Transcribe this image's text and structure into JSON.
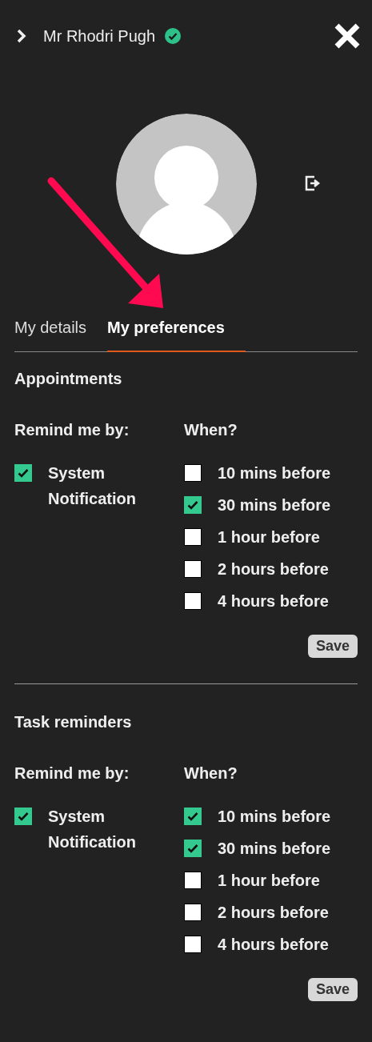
{
  "header": {
    "name": "Mr Rhodri Pugh",
    "verified": true
  },
  "tabs": [
    {
      "label": "My details",
      "selected": false
    },
    {
      "label": "My preferences",
      "selected": true
    }
  ],
  "sections": [
    {
      "title": "Appointments",
      "remind_label": "Remind me by:",
      "when_label": "When?",
      "methods": [
        {
          "label": "System Notification",
          "checked": true
        }
      ],
      "times": [
        {
          "label": "10 mins before",
          "checked": false
        },
        {
          "label": "30 mins before",
          "checked": true
        },
        {
          "label": "1 hour before",
          "checked": false
        },
        {
          "label": "2 hours before",
          "checked": false
        },
        {
          "label": "4 hours before",
          "checked": false
        }
      ],
      "save_label": "Save"
    },
    {
      "title": "Task reminders",
      "remind_label": "Remind me by:",
      "when_label": "When?",
      "methods": [
        {
          "label": "System Notification",
          "checked": true
        }
      ],
      "times": [
        {
          "label": "10 mins before",
          "checked": true
        },
        {
          "label": "30 mins before",
          "checked": true
        },
        {
          "label": "1 hour before",
          "checked": false
        },
        {
          "label": "2 hours before",
          "checked": false
        },
        {
          "label": "4 hours before",
          "checked": false
        }
      ],
      "save_label": "Save"
    }
  ]
}
